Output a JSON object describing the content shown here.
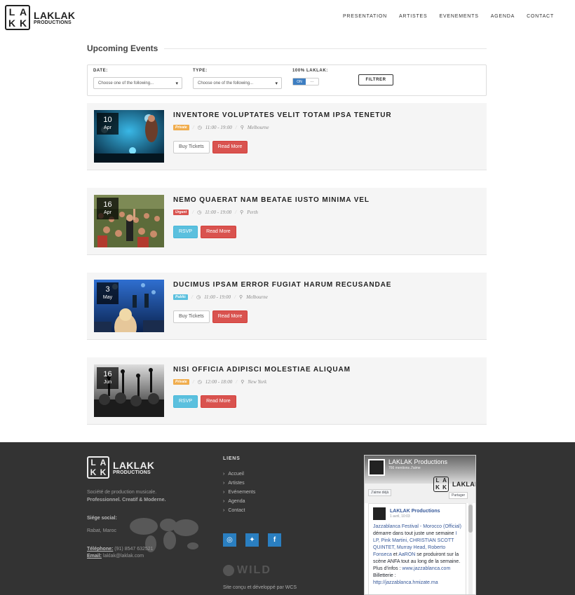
{
  "brand": {
    "name": "LAKLAK",
    "sub": "PRODUCTIONS",
    "mark": [
      "L",
      "A",
      "K",
      "K"
    ]
  },
  "nav": [
    "PRESENTATION",
    "ARTISTES",
    "EVENEMENTS",
    "AGENDA",
    "CONTACT"
  ],
  "page_title": "Upcoming Events",
  "filter": {
    "date_label": "DATE:",
    "date_placeholder": "Choose one of the following...",
    "type_label": "TYPE:",
    "type_placeholder": "Choose one of the following...",
    "laklak_label": "100% LAKLAK:",
    "toggle_on": "ON",
    "toggle_off": "---",
    "button": "FILTRER"
  },
  "events": [
    {
      "day": "10",
      "month": "Apr",
      "title": "INVENTORE VOLUPTATES VELIT TOTAM IPSA TENETUR",
      "badge": "Private",
      "badge_color": "#f0ad4e",
      "time": "11:00 - 19:00",
      "location": "Melbourne",
      "btn1": "Buy Tickets",
      "btn1_style": "default",
      "btn2": "Read More",
      "image": "concert-singer-blue-lights"
    },
    {
      "day": "16",
      "month": "Apr",
      "title": "NEMO QUAERAT NAM BEATAE IUSTO MINIMA VEL",
      "badge": "Urgent",
      "badge_color": "#d9534f",
      "time": "11:00 - 19:00",
      "location": "Perth",
      "btn1": "RSVP",
      "btn1_style": "info",
      "btn2": "Read More",
      "image": "festival-crowd"
    },
    {
      "day": "3",
      "month": "May",
      "title": "DUCIMUS IPSAM ERROR FUGIAT HARUM RECUSANDAE",
      "badge": "Public",
      "badge_color": "#5bc0de",
      "time": "11:00 - 19:00",
      "location": "Melbourne",
      "btn1": "Buy Tickets",
      "btn1_style": "default",
      "btn2": "Read More",
      "image": "stage-crowd-blue"
    },
    {
      "day": "16",
      "month": "Jun",
      "title": "NISI OFFICIA ADIPISCI MOLESTIAE ALIQUAM",
      "badge": "Private",
      "badge_color": "#f0ad4e",
      "time": "12:00 - 18:00",
      "location": "New York",
      "btn1": "RSVP",
      "btn1_style": "info",
      "btn2": "Read More",
      "image": "bw-crowd-hands"
    }
  ],
  "footer": {
    "desc_line1": "Société de production musicale.",
    "desc_line2": "Professionnel. Creatif & Moderne.",
    "siege_label": "Siége social:",
    "siege_value": "Rabat, Maroc",
    "tel_label": "Téléphone:",
    "tel_value": "(91) 8547 632521",
    "email_label": "Email:",
    "email_value": "laklak@laklak.com",
    "liens_title": "LIENS",
    "liens": [
      "Accueil",
      "Artistes",
      "Evénements",
      "Agenda",
      "Contact"
    ],
    "social": [
      "instagram-icon",
      "twitter-icon",
      "facebook-icon"
    ],
    "wild": "WILD",
    "credit": "Site conçu et développé par WCS"
  },
  "fb": {
    "page_name": "LAKLAK Productions",
    "likes": "766 mentions J'aime",
    "like_btn": "J'aime déjà",
    "share_btn": "Partager",
    "post_author": "LAKLAK Productions",
    "post_date": "1 avril, 10:03",
    "post_text_1": "Jazzablanca Festival - Morocco (Official)",
    "post_text_2": " démarre dans tout juste une semaine ",
    "post_text_3": "I LP, Pink Martini, CHRISTIAN SCOTT QUINTET, Murray Head, Roberto Fonseca",
    "post_text_4": " et ",
    "post_text_5": "AaRON",
    "post_text_6": " se produiront sur la scène ANFA tout au long de la semaine.",
    "post_text_7": "Plus d'infos : ",
    "post_text_8": "www.jazzablanca.com",
    "post_text_9": "Billetterie :",
    "post_text_10": "http://jazzablanca.hmizate.ma"
  },
  "colors": {
    "accent_blue": "#2a7fc1",
    "btn_red": "#d9534f",
    "btn_info": "#5bc0de",
    "footer_bg": "#333333"
  }
}
